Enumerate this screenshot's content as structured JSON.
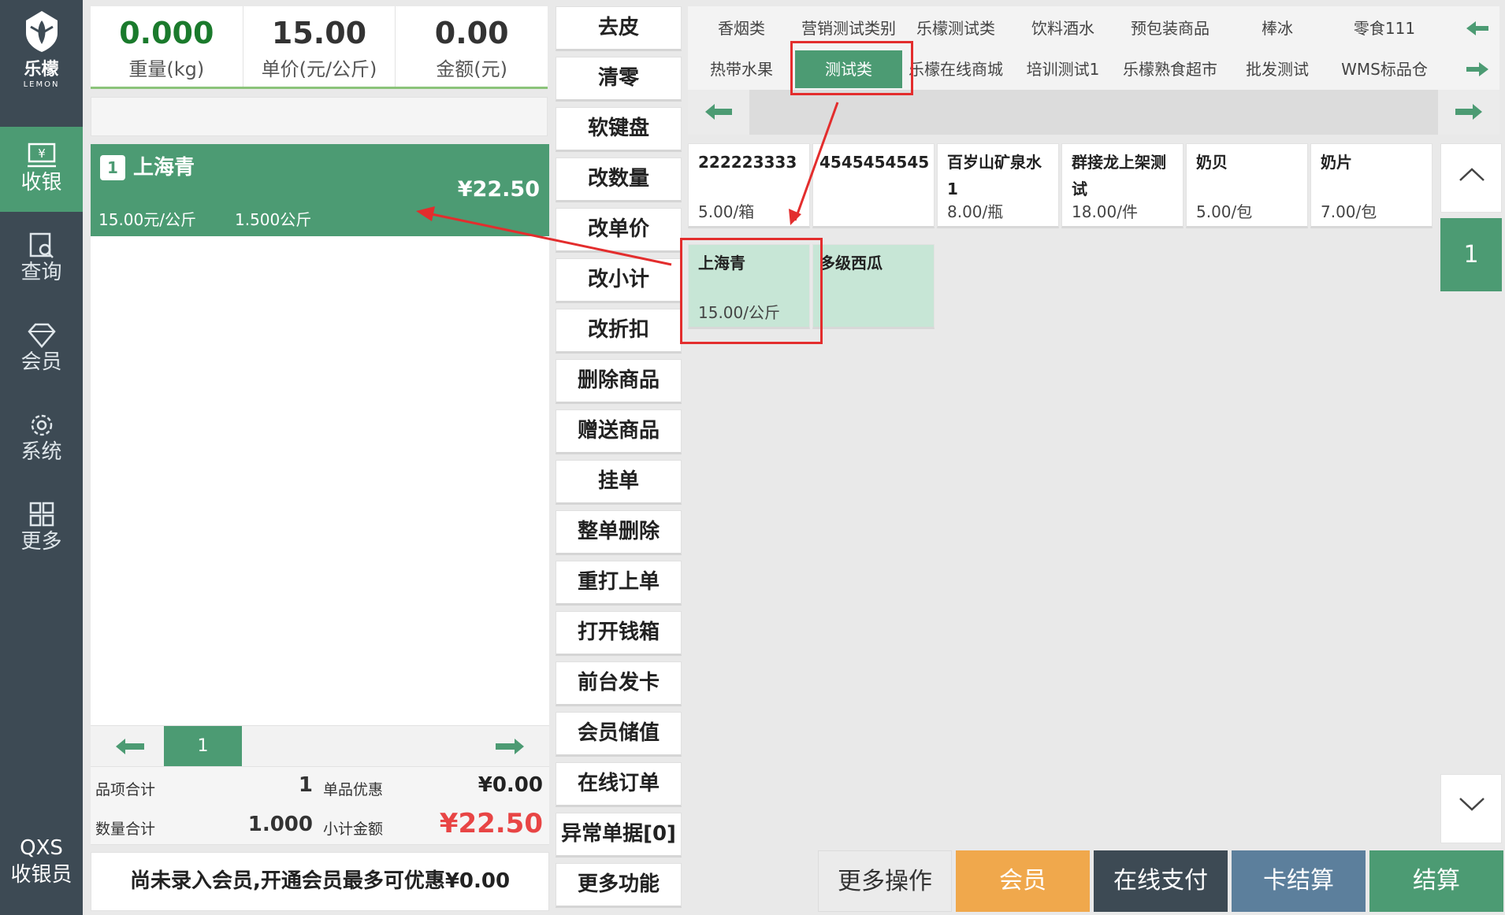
{
  "brand": {
    "name": "乐檬",
    "sub": "LEMON"
  },
  "nav": [
    {
      "label": "收银",
      "icon": "cash-register-icon"
    },
    {
      "label": "查询",
      "icon": "search-document-icon"
    },
    {
      "label": "会员",
      "icon": "diamond-icon"
    },
    {
      "label": "系统",
      "icon": "gear-icon"
    },
    {
      "label": "更多",
      "icon": "grid-icon"
    }
  ],
  "user": {
    "name": "QXS",
    "role": "收银员"
  },
  "display": {
    "weight": {
      "value": "0.000",
      "label": "重量(kg)"
    },
    "unit_price": {
      "value": "15.00",
      "label": "单价(元/公斤)"
    },
    "amount": {
      "value": "0.00",
      "label": "金额(元)"
    }
  },
  "cart": {
    "items": [
      {
        "index": "1",
        "name": "上海青",
        "total": "¥22.50",
        "unit_price": "15.00元/公斤",
        "qty": "1.500公斤"
      }
    ],
    "page": "1"
  },
  "summary": {
    "item_count_label": "品项合计",
    "item_count": "1",
    "discount_label": "单品优惠",
    "discount": "¥0.00",
    "qty_label": "数量合计",
    "qty": "1.000",
    "subtotal_label": "小计金额",
    "subtotal": "¥22.50"
  },
  "member_hint": "尚未录入会员,开通会员最多可优惠¥0.00",
  "functions": [
    "去皮",
    "清零",
    "软键盘",
    "改数量",
    "改单价",
    "改小计",
    "改折扣",
    "删除商品",
    "赠送商品",
    "挂单",
    "整单删除",
    "重打上单",
    "打开钱箱",
    "前台发卡",
    "会员储值",
    "在线订单",
    "异常单据[0]",
    "更多功能"
  ],
  "categories_row1": [
    "香烟类",
    "营销测试类别",
    "乐檬测试类",
    "饮料酒水",
    "预包装商品",
    "棒冰",
    "零食111"
  ],
  "categories_row2": [
    "热带水果",
    "测试类",
    "乐檬在线商城",
    "培训测试1",
    "乐檬熟食超市",
    "批发测试",
    "WMS标品仓"
  ],
  "products_row1": [
    {
      "name": "222223333",
      "price": "5.00/箱"
    },
    {
      "name": "4545454545",
      "price": ""
    },
    {
      "name": "百岁山矿泉水1",
      "price": "8.00/瓶"
    },
    {
      "name": "群接龙上架测试",
      "price": "18.00/件"
    },
    {
      "name": "奶贝",
      "price": "5.00/包"
    },
    {
      "name": "奶片",
      "price": "7.00/包"
    }
  ],
  "products_row2": [
    {
      "name": "上海青",
      "price": "15.00/公斤"
    },
    {
      "name": "多级西瓜",
      "price": ""
    }
  ],
  "product_page": "1",
  "actions": [
    "更多操作",
    "会员",
    "在线支付",
    "卡结算",
    "结算"
  ],
  "colors": {
    "sidebar": "#3d4a54",
    "accent": "#4c9b73",
    "orange": "#f0a84c",
    "dark": "#3d4a54",
    "blue": "#5c7f9c",
    "red": "#e84545",
    "highlight": "#e32d2d"
  }
}
